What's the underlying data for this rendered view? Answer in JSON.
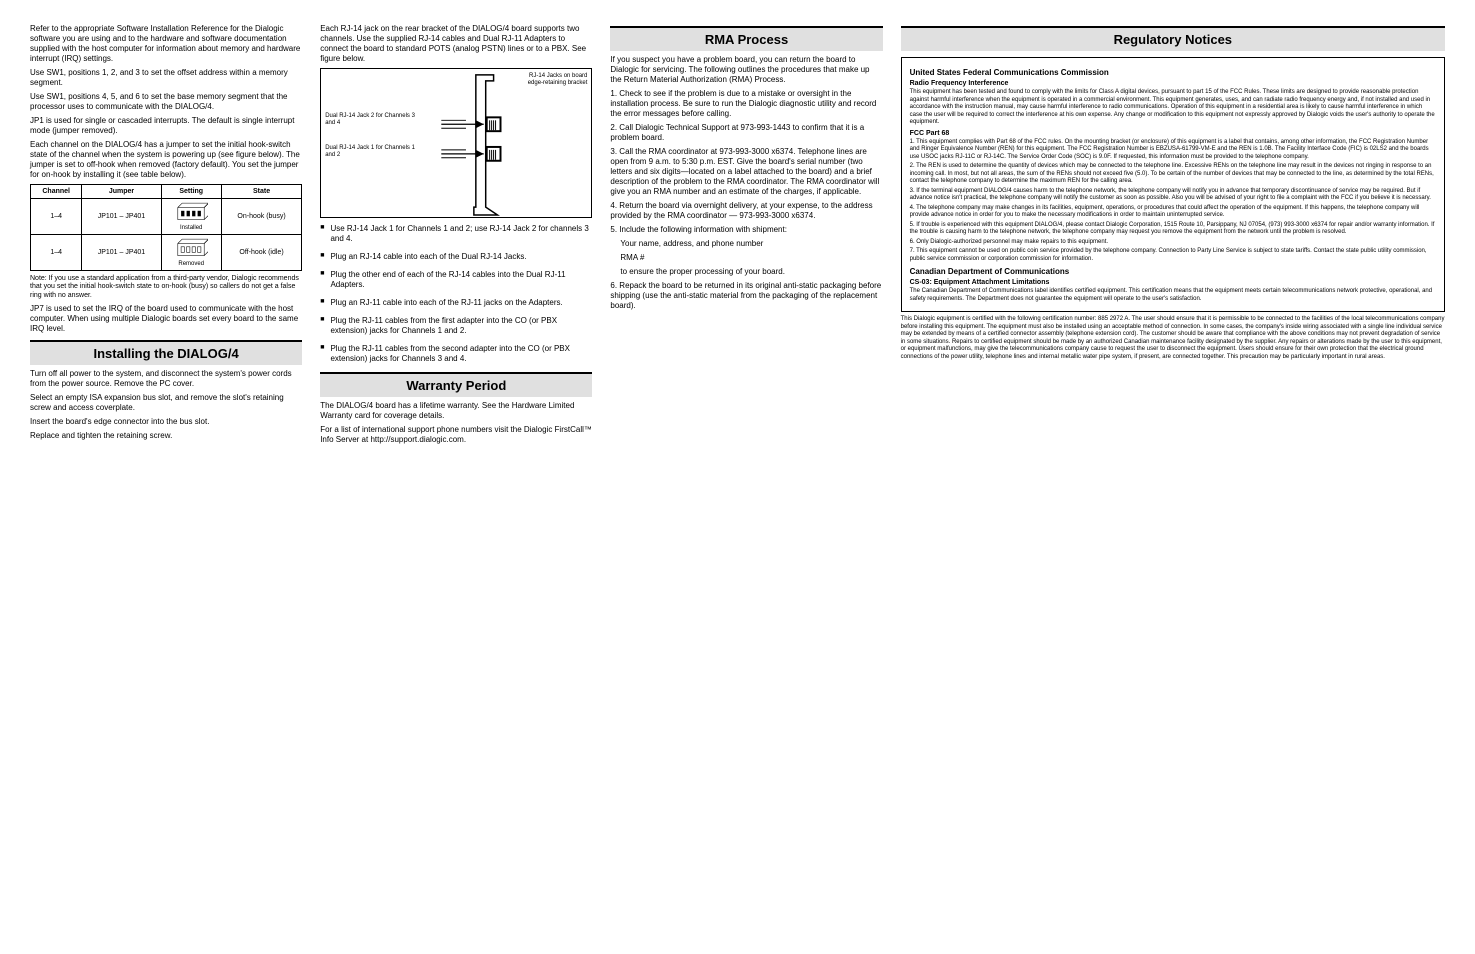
{
  "col1": {
    "para1": "Refer to the appropriate Software Installation Reference for the Dialogic software you are using and to the hardware and software documentation supplied with the host computer for information about memory and hardware interrupt (IRQ) settings.",
    "para2": "Use SW1, positions 1, 2, and 3 to set the offset address within a memory segment.",
    "para3": "Use SW1, positions 4, 5, and 6 to set the base memory segment that the processor uses to communicate with the DIALOG/4.",
    "para4": "JP1 is used for single or cascaded interrupts. The default is single interrupt mode (jumper removed).",
    "para5": "Each channel on the DIALOG/4 has a jumper to set the initial hook-switch state of the channel when the system is powering up (see figure below). The jumper is set to off-hook when removed (factory default). You set the jumper for on-hook by installing it (see table below).",
    "table": {
      "headers": [
        "Channel",
        "Jumper",
        "Setting",
        "State"
      ],
      "rows": [
        {
          "channel": "1–4",
          "jumper": "JP101 – JP401",
          "setting_label": "Installed",
          "state": "On-hook (busy)"
        },
        {
          "channel": "1–4",
          "jumper": "JP101 – JP401",
          "setting_label": "Removed",
          "state": "Off-hook (idle)"
        }
      ]
    },
    "note": "Note: If you use a standard application from a third-party vendor, Dialogic recommends that you set the initial hook-switch state to on-hook (busy) so callers do not get a false ring with no answer.",
    "irq_para": "JP7 is used to set the IRQ of the board used to communicate with the host computer. When using multiple Dialogic boards set every board to the same IRQ level.",
    "installing_title": "Installing the DIALOG/4",
    "install_p1": "Turn off all power to the system, and disconnect the system's power cords from the power source. Remove the PC cover.",
    "install_p2": "Select an empty ISA expansion bus slot, and remove the slot's retaining screw and access coverplate.",
    "install_p3": "Insert the board's edge connector into the bus slot.",
    "install_p4": "Replace and tighten the retaining screw."
  },
  "col2": {
    "cable_para": "Each RJ-14 jack on the rear bracket of the DIALOG/4 board supports two channels. Use the supplied RJ-14 cables and Dual RJ-11 Adapters to connect the board to standard POTS (analog PSTN) lines or to a PBX. See figure below.",
    "bullets": [
      "Use RJ-14 Jack 1 for Channels 1 and 2; use RJ-14 Jack 2 for channels 3 and 4.",
      "Plug an RJ-14 cable into each of the Dual RJ-14 Jacks.",
      "Plug the other end of each of the RJ-14 cables into the Dual RJ-11 Adapters.",
      "Plug an RJ-11 cable into each of the RJ-11 jacks on the Adapters.",
      "Plug the RJ-11 cables from the first adapter into the CO (or PBX extension) jacks for Channels 1 and 2.",
      "Plug the RJ-11 cables from the second adapter into the CO (or PBX extension) jacks for Channels 3 and 4."
    ],
    "warranty_title": "Warranty Period",
    "warranty_p1": "The DIALOG/4 board has a lifetime warranty. See the Hardware Limited Warranty card for coverage details.",
    "warranty_p2": "For a list of international support phone numbers visit the Dialogic FirstCall™ Info Server at http://support.dialogic.com.",
    "fig_labels": {
      "jack1": "Dual RJ-14 Jack 2 for Channels 3 and 4",
      "jack2": "Dual RJ-14 Jack 1 for Channels 1 and 2",
      "plate": "RJ-14 Jacks on board edge-retaining bracket"
    }
  },
  "col3": {
    "rma_title": "RMA Process",
    "p1": "If you suspect you have a problem board, you can return the board to Dialogic for servicing. The following outlines the procedures that make up the Return Material Authorization (RMA) Process.",
    "s1": "1. Check to see if the problem is due to a mistake or oversight in the installation process. Be sure to run the Dialogic diagnostic utility and record the error messages before calling.",
    "s2": "2. Call Dialogic Technical Support at 973-993-1443 to confirm that it is a problem board.",
    "s3": "3. Call the RMA coordinator at 973-993-3000 x6374. Telephone lines are open from 9 a.m. to 5:30 p.m. EST. Give the board's serial number (two letters and six digits—located on a label attached to the board) and a brief description of the problem to the RMA coordinator. The RMA coordinator will give you an RMA number and an estimate of the charges, if applicable.",
    "s4": "4. Return the board via overnight delivery, at your expense, to the address provided by the RMA coordinator — 973-993-3000 x6374.",
    "s5_lead": "5. Include the following information with shipment:",
    "s5a": "Your name, address, and phone number",
    "s5b": "RMA #",
    "s5_tail": "to ensure the proper processing of your board.",
    "s6": "6. Repack the board to be returned in its original anti-static packaging before shipping (use the anti-static material from the packaging of the replacement board)."
  },
  "col4": {
    "reg_title": "Regulatory Notices",
    "us_fcc_title": "United States Federal Communications Commission",
    "radio_hdr": "Radio Frequency Interference",
    "radio_p": "This equipment has been tested and found to comply with the limits for Class A digital devices, pursuant to part 15 of the FCC Rules. These limits are designed to provide reasonable protection against harmful interference when the equipment is operated in a commercial environment. This equipment generates, uses, and can radiate radio frequency energy and, if not installed and used in accordance with the instruction manual, may cause harmful interference to radio communications. Operation of this equipment in a residential area is likely to cause harmful interference in which case the user will be required to correct the interference at his own expense. Any change or modification to this equipment not expressly approved by Dialogic voids the user's authority to operate the equipment.",
    "part68_hdr": "FCC Part 68",
    "part68_1": "1. This equipment complies with Part 68 of the FCC rules. On the mounting bracket (or enclosure) of this equipment is a label that contains, among other information, the FCC Registration Number and Ringer Equivalence Number (REN) for this equipment. The FCC Registration Number is EBZUSA-61799-VM-E and the REN is 1.0B. The Facility Interface Code (FIC) is 02LS2 and the boards use USOC jacks RJ-11C or RJ-14C. The Service Order Code (SOC) is 9.0F. If requested, this information must be provided to the telephone company.",
    "part68_2": "2. The REN is used to determine the quantity of devices which may be connected to the telephone line. Excessive RENs on the telephone line may result in the devices not ringing in response to an incoming call. In most, but not all areas, the sum of the RENs should not exceed five (5.0). To be certain of the number of devices that may be connected to the line, as determined by the total RENs, contact the telephone company to determine the maximum REN for the calling area.",
    "part68_3": "3. If the terminal equipment DIALOG/4 causes harm to the telephone network, the telephone company will notify you in advance that temporary discontinuance of service may be required. But if advance notice isn't practical, the telephone company will notify the customer as soon as possible. Also you will be advised of your right to file a complaint with the FCC if you believe it is necessary.",
    "part68_4": "4. The telephone company may make changes in its facilities, equipment, operations, or procedures that could affect the operation of the equipment. If this happens, the telephone company will provide advance notice in order for you to make the necessary modifications in order to maintain uninterrupted service.",
    "part68_5": "5. If trouble is experienced with this equipment DIALOG/4, please contact Dialogic Corporation, 1515 Route 10, Parsippany, NJ 07054, (973) 993-3000 x6374 for repair and/or warranty information. If the trouble is causing harm to the telephone network, the telephone company may request you remove the equipment from the network until the problem is resolved.",
    "part68_6": "6. Only Dialogic-authorized personnel may make repairs to this equipment.",
    "part68_7": "7. This equipment cannot be used on public coin service provided by the telephone company. Connection to Party Line Service is subject to state tariffs. Contact the state public utility commission, public service commission or corporation commission for information.",
    "canada_hdr": "Canadian Department of Communications",
    "cs03_hdr": "CS-03: Equipment Attachment Limitations",
    "cs03_p1": "The Canadian Department of Communications label identifies certified equipment. This certification means that the equipment meets certain telecommunications network protective, operational, and safety requirements. The Department does not guarantee the equipment will operate to the user's satisfaction.",
    "footer": "This Dialogic equipment is certified with the following certification number: 885 2972 A. The user should ensure that it is permissible to be connected to the facilities of the local telecommunications company before installing this equipment. The equipment must also be installed using an acceptable method of connection. In some cases, the company's inside wiring associated with a single line individual service may be extended by means of a certified connector assembly (telephone extension cord). The customer should be aware that compliance with the above conditions may not prevent degradation of service in some situations. Repairs to certified equipment should be made by an authorized Canadian maintenance facility designated by the supplier. Any repairs or alterations made by the user to this equipment, or equipment malfunctions, may give the telecommunications company cause to request the user to disconnect the equipment. Users should ensure for their own protection that the electrical ground connections of the power utility, telephone lines and internal metallic water pipe system, if present, are connected together. This precaution may be particularly important in rural areas."
  }
}
